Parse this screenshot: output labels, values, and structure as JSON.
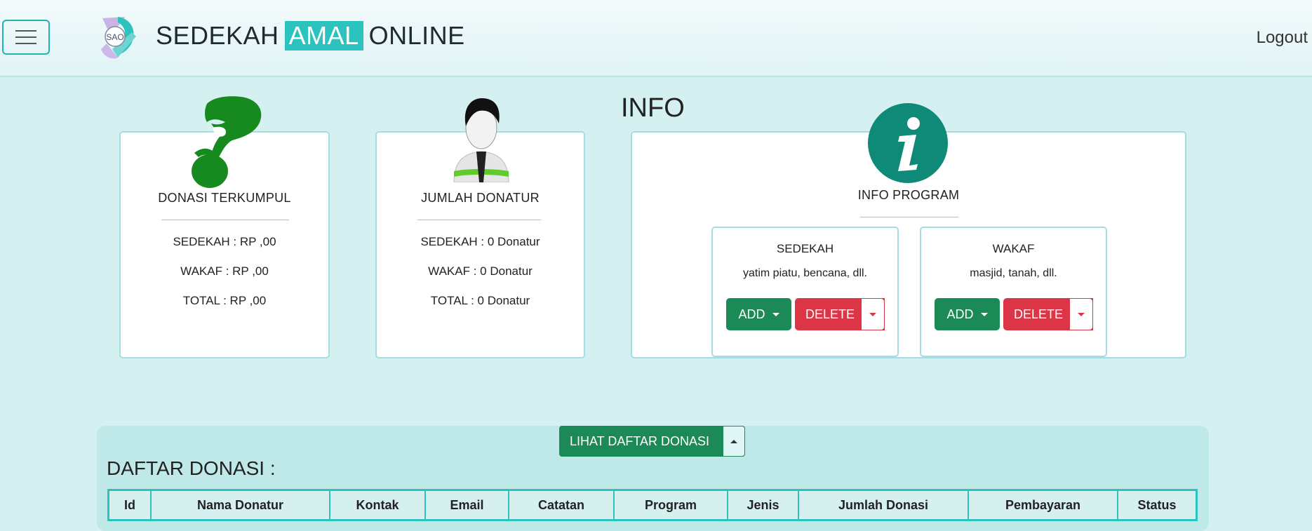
{
  "header": {
    "brand_pre": "SEDEKAH",
    "brand_highlight": "AMAL",
    "brand_post": "ONLINE",
    "logo_text": "SAO",
    "logout": "Logout"
  },
  "info_heading": "INFO",
  "cards": {
    "donasi": {
      "title": "DONASI TERKUMPUL",
      "sedekah": "SEDEKAH : RP ,00",
      "wakaf": "WAKAF : RP ,00",
      "total": "TOTAL : RP ,00"
    },
    "donatur": {
      "title": "JUMLAH DONATUR",
      "sedekah": "SEDEKAH : 0 Donatur",
      "wakaf": "WAKAF : 0 Donatur",
      "total": "TOTAL : 0 Donatur"
    },
    "info": {
      "title": "INFO PROGRAM",
      "programs": [
        {
          "title": "SEDEKAH",
          "desc": "yatim piatu, bencana, dll.",
          "add": "ADD",
          "delete": "DELETE"
        },
        {
          "title": "WAKAF",
          "desc": "masjid, tanah, dll.",
          "add": "ADD",
          "delete": "DELETE"
        }
      ]
    }
  },
  "daftar": {
    "button": "LIHAT DAFTAR DONASI",
    "title": "DAFTAR DONASI :",
    "columns": [
      "Id",
      "Nama Donatur",
      "Kontak",
      "Email",
      "Catatan",
      "Program",
      "Jenis",
      "Jumlah Donasi",
      "Pembayaran",
      "Status"
    ]
  },
  "colors": {
    "accent": "#2cc2be",
    "success": "#1b8a56",
    "danger": "#dc3545",
    "background": "#d5f0f0"
  },
  "icons": [
    "menu-icon",
    "hand-coin-icon",
    "donor-person-icon",
    "info-icon"
  ]
}
